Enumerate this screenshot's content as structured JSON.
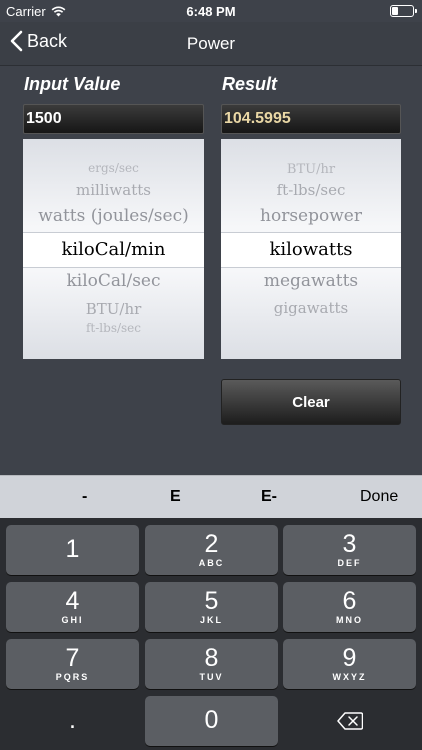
{
  "status": {
    "carrier": "Carrier",
    "time": "6:48 PM"
  },
  "nav": {
    "back_label": "Back",
    "title": "Power"
  },
  "input": {
    "label": "Input Value",
    "value": "1500"
  },
  "result": {
    "label": "Result",
    "value": "104.5995"
  },
  "input_picker": {
    "items": [
      "ergs/sec",
      "milliwatts",
      "watts (joules/sec)",
      "kiloCal/min",
      "kiloCal/sec",
      "BTU/hr",
      "ft-lbs/sec"
    ],
    "selected": "kiloCal/min"
  },
  "result_picker": {
    "items": [
      "BTU/hr",
      "ft-lbs/sec",
      "horsepower",
      "kilowatts",
      "megawatts",
      "gigawatts"
    ],
    "selected": "kilowatts"
  },
  "clear_label": "Clear",
  "accessory": {
    "minus": "-",
    "e": "E",
    "e_minus": "E-",
    "done": "Done"
  },
  "keys": [
    {
      "num": "1",
      "letters": ""
    },
    {
      "num": "2",
      "letters": "ABC"
    },
    {
      "num": "3",
      "letters": "DEF"
    },
    {
      "num": "4",
      "letters": "GHI"
    },
    {
      "num": "5",
      "letters": "JKL"
    },
    {
      "num": "6",
      "letters": "MNO"
    },
    {
      "num": "7",
      "letters": "PQRS"
    },
    {
      "num": "8",
      "letters": "TUV"
    },
    {
      "num": "9",
      "letters": "WXYZ"
    },
    {
      "num": ".",
      "letters": ""
    },
    {
      "num": "0",
      "letters": ""
    }
  ],
  "colors": {
    "result_text": "#e9d7a5",
    "input_text": "#ffffff",
    "background": "#3e424a"
  }
}
